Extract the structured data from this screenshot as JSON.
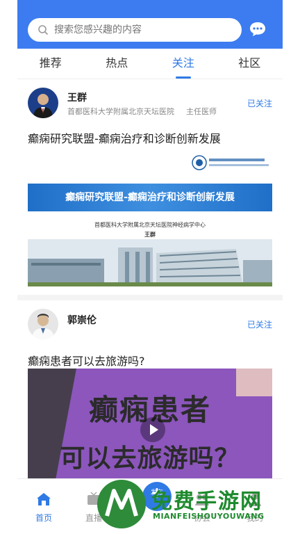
{
  "search": {
    "placeholder": "搜索您感兴趣的内容"
  },
  "tabs": [
    {
      "label": "推荐",
      "active": false
    },
    {
      "label": "热点",
      "active": false
    },
    {
      "label": "关注",
      "active": true
    },
    {
      "label": "社区",
      "active": false
    }
  ],
  "posts": [
    {
      "author": "王群",
      "hospital": "首都医科大学附属北京天坛医院",
      "role": "主任医师",
      "follow_label": "已关注",
      "title": "癫痫研究联盟-癫痫治疗和诊断创新发展",
      "cover": {
        "banner": "癫痫研究联盟-癫痫治疗和诊断创新发展",
        "subtitle": "首都医科大学附属北京天坛医院神经病学中心",
        "name": "王群"
      }
    },
    {
      "author": "郭崇伦",
      "follow_label": "已关注",
      "title": "癫痫患者可以去旅游吗?",
      "video": {
        "line1": "癫痫患者",
        "line2": "可以去旅游吗？"
      }
    }
  ],
  "bottom_nav": [
    {
      "label": "首页",
      "icon": "home-icon",
      "active": true
    },
    {
      "label": "直播",
      "icon": "tv-icon",
      "active": false
    },
    {
      "label": "发布",
      "icon": "plus-icon",
      "active": false
    },
    {
      "label": "协会",
      "icon": "group-icon",
      "active": false
    },
    {
      "label": "我的",
      "icon": "user-icon",
      "active": false
    }
  ],
  "watermark": {
    "title": "免费手游网",
    "subtitle": "MIANFEISHOUYOUWANG"
  },
  "colors": {
    "header": "#3c7cf0",
    "accent": "#2f7ae5",
    "watermark": "#1e8a2e"
  }
}
